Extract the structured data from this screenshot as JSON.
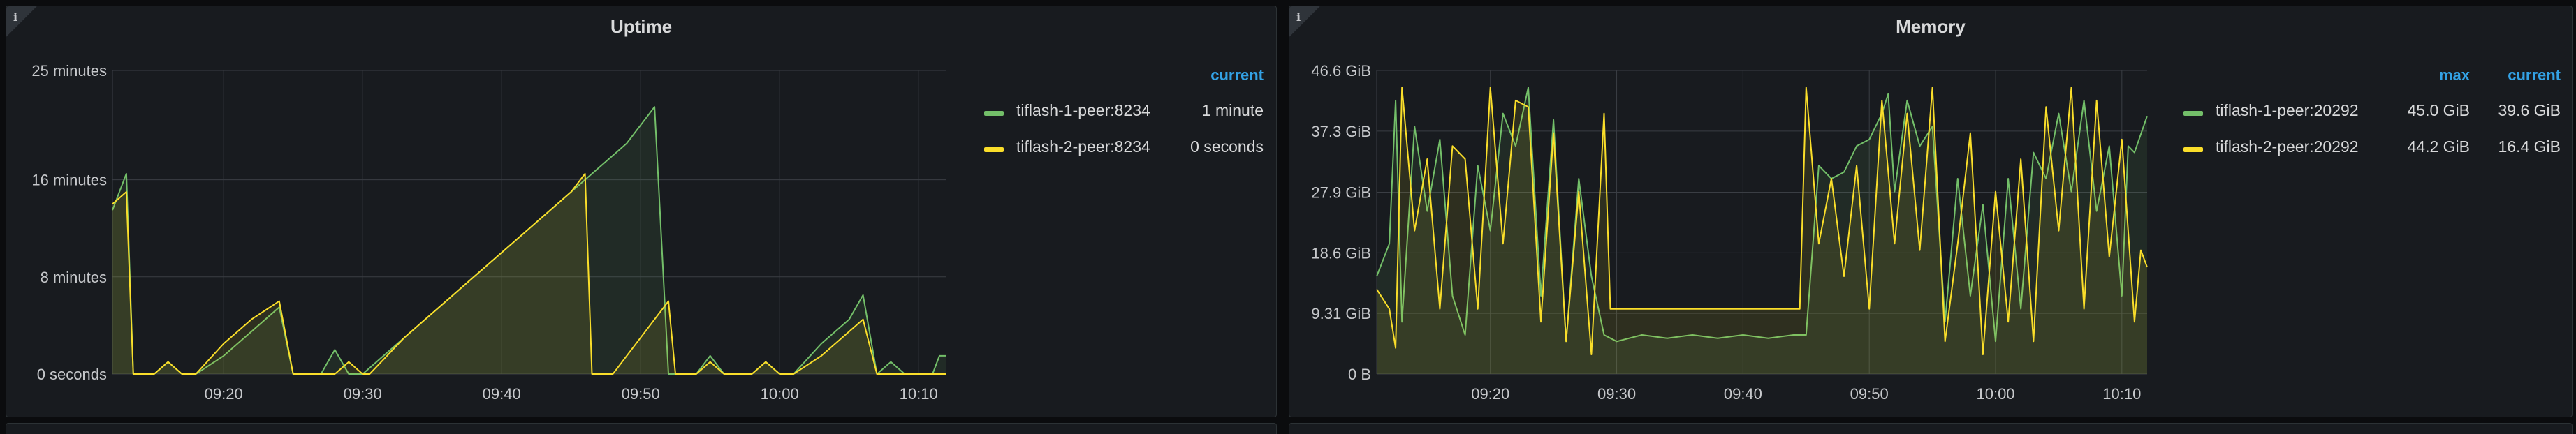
{
  "panels": [
    {
      "title": "Uptime",
      "info_icon": "info-icon",
      "legend": {
        "columns": [
          "current"
        ],
        "rows": [
          {
            "name": "tiflash-1-peer:8234",
            "color": "#73bf69",
            "values": [
              "1 minute"
            ]
          },
          {
            "name": "tiflash-2-peer:8234",
            "color": "#fade2a",
            "values": [
              "0 seconds"
            ]
          }
        ]
      }
    },
    {
      "title": "Memory",
      "info_icon": "info-icon",
      "legend": {
        "columns": [
          "max",
          "current"
        ],
        "rows": [
          {
            "name": "tiflash-1-peer:20292",
            "color": "#73bf69",
            "values": [
              "45.0 GiB",
              "39.6 GiB"
            ]
          },
          {
            "name": "tiflash-2-peer:20292",
            "color": "#fade2a",
            "values": [
              "44.2 GiB",
              "16.4 GiB"
            ]
          }
        ]
      }
    }
  ],
  "chart_data": [
    {
      "type": "area",
      "title": "Uptime",
      "x_unit": "time (HH:MM)",
      "x_ticks": [
        "09:20",
        "09:30",
        "09:40",
        "09:50",
        "10:00",
        "10:10"
      ],
      "x_range": [
        "09:12",
        "10:12"
      ],
      "y_unit": "minutes",
      "y_ticks": [
        {
          "value": 0,
          "label": "0 seconds"
        },
        {
          "value": 8,
          "label": "8 minutes"
        },
        {
          "value": 16,
          "label": "16 minutes"
        },
        {
          "value": 25,
          "label": "25 minutes"
        }
      ],
      "ylim": [
        0,
        25
      ],
      "grid": true,
      "legend_placement": "right",
      "series": [
        {
          "name": "tiflash-1-peer:8234",
          "color": "#73bf69",
          "points": [
            [
              "09:12",
              13.5
            ],
            [
              "09:13",
              16.5
            ],
            [
              "09:13.5",
              0
            ],
            [
              "09:15",
              0
            ],
            [
              "09:16",
              1
            ],
            [
              "09:17",
              0
            ],
            [
              "09:18",
              0
            ],
            [
              "09:20",
              1.5
            ],
            [
              "09:22",
              3.5
            ],
            [
              "09:24",
              5.5
            ],
            [
              "09:25",
              0
            ],
            [
              "09:27",
              0
            ],
            [
              "09:28",
              2
            ],
            [
              "09:29",
              0
            ],
            [
              "09:30",
              0
            ],
            [
              "09:32",
              2
            ],
            [
              "09:35",
              5
            ],
            [
              "09:38",
              8
            ],
            [
              "09:41",
              11
            ],
            [
              "09:44",
              14
            ],
            [
              "09:47",
              17
            ],
            [
              "09:49",
              19
            ],
            [
              "09:51",
              22
            ],
            [
              "09:52",
              0
            ],
            [
              "09:54",
              0
            ],
            [
              "09:55",
              1.5
            ],
            [
              "09:56",
              0
            ],
            [
              "09:58",
              0
            ],
            [
              "09:59",
              1
            ],
            [
              "10:00",
              0
            ],
            [
              "10:01",
              0
            ],
            [
              "10:03",
              2.5
            ],
            [
              "10:05",
              4.5
            ],
            [
              "10:06",
              6.5
            ],
            [
              "10:07",
              0
            ],
            [
              "10:08",
              1
            ],
            [
              "10:09",
              0
            ],
            [
              "10:11",
              0
            ],
            [
              "10:11.5",
              1.5
            ],
            [
              "10:12",
              1.5
            ]
          ]
        },
        {
          "name": "tiflash-2-peer:8234",
          "color": "#fade2a",
          "points": [
            [
              "09:12",
              14
            ],
            [
              "09:13",
              15
            ],
            [
              "09:13.5",
              0
            ],
            [
              "09:15",
              0
            ],
            [
              "09:16",
              1
            ],
            [
              "09:17",
              0
            ],
            [
              "09:18",
              0
            ],
            [
              "09:20",
              2.5
            ],
            [
              "09:22",
              4.5
            ],
            [
              "09:24",
              6
            ],
            [
              "09:25",
              0
            ],
            [
              "09:28",
              0
            ],
            [
              "09:29",
              1
            ],
            [
              "09:30",
              0
            ],
            [
              "09:30.5",
              0
            ],
            [
              "09:33",
              3
            ],
            [
              "09:36",
              6
            ],
            [
              "09:39",
              9
            ],
            [
              "09:42",
              12
            ],
            [
              "09:45",
              15
            ],
            [
              "09:46",
              16.5
            ],
            [
              "09:46.5",
              0
            ],
            [
              "09:48",
              0
            ],
            [
              "09:50",
              3
            ],
            [
              "09:52",
              6
            ],
            [
              "09:52.5",
              0
            ],
            [
              "09:54",
              0
            ],
            [
              "09:55",
              1
            ],
            [
              "09:56",
              0
            ],
            [
              "09:58",
              0
            ],
            [
              "09:59",
              1
            ],
            [
              "10:00",
              0
            ],
            [
              "10:01",
              0
            ],
            [
              "10:03",
              1.5
            ],
            [
              "10:05",
              3.5
            ],
            [
              "10:06",
              4.5
            ],
            [
              "10:07",
              0
            ],
            [
              "10:12",
              0
            ]
          ]
        }
      ]
    },
    {
      "type": "area",
      "title": "Memory",
      "x_unit": "time (HH:MM)",
      "x_ticks": [
        "09:20",
        "09:30",
        "09:40",
        "09:50",
        "10:00",
        "10:10"
      ],
      "x_range": [
        "09:11",
        "10:12"
      ],
      "y_unit": "GiB",
      "y_ticks": [
        {
          "value": 0,
          "label": "0 B"
        },
        {
          "value": 9.31,
          "label": "9.31 GiB"
        },
        {
          "value": 18.6,
          "label": "18.6 GiB"
        },
        {
          "value": 27.9,
          "label": "27.9 GiB"
        },
        {
          "value": 37.3,
          "label": "37.3 GiB"
        },
        {
          "value": 46.6,
          "label": "46.6 GiB"
        }
      ],
      "ylim": [
        0,
        46.6
      ],
      "grid": true,
      "legend_placement": "right",
      "series": [
        {
          "name": "tiflash-1-peer:20292",
          "color": "#73bf69",
          "points": [
            [
              "09:11",
              15
            ],
            [
              "09:12",
              20
            ],
            [
              "09:12.5",
              42
            ],
            [
              "09:13",
              8
            ],
            [
              "09:14",
              38
            ],
            [
              "09:15",
              25
            ],
            [
              "09:16",
              36
            ],
            [
              "09:17",
              12
            ],
            [
              "09:18",
              6
            ],
            [
              "09:19",
              32
            ],
            [
              "09:20",
              22
            ],
            [
              "09:21",
              40
            ],
            [
              "09:22",
              35
            ],
            [
              "09:23",
              44
            ],
            [
              "09:24",
              12
            ],
            [
              "09:25",
              39
            ],
            [
              "09:26",
              5
            ],
            [
              "09:27",
              30
            ],
            [
              "09:28",
              15
            ],
            [
              "09:29",
              6
            ],
            [
              "09:30",
              5
            ],
            [
              "09:32",
              6
            ],
            [
              "09:34",
              5.5
            ],
            [
              "09:36",
              6
            ],
            [
              "09:38",
              5.5
            ],
            [
              "09:40",
              6
            ],
            [
              "09:42",
              5.5
            ],
            [
              "09:44",
              6
            ],
            [
              "09:45",
              6
            ],
            [
              "09:46",
              32
            ],
            [
              "09:47",
              30
            ],
            [
              "09:48",
              31
            ],
            [
              "09:49",
              35
            ],
            [
              "09:50",
              36
            ],
            [
              "09:51",
              40
            ],
            [
              "09:51.5",
              43
            ],
            [
              "09:52",
              28
            ],
            [
              "09:53",
              42
            ],
            [
              "09:54",
              35
            ],
            [
              "09:55",
              38
            ],
            [
              "09:56",
              8
            ],
            [
              "09:57",
              30
            ],
            [
              "09:58",
              12
            ],
            [
              "09:59",
              26
            ],
            [
              "10:00",
              5
            ],
            [
              "10:01",
              30
            ],
            [
              "10:02",
              10
            ],
            [
              "10:03",
              34
            ],
            [
              "10:04",
              30
            ],
            [
              "10:05",
              40
            ],
            [
              "10:06",
              28
            ],
            [
              "10:07",
              42
            ],
            [
              "10:08",
              25
            ],
            [
              "10:09",
              35
            ],
            [
              "10:10",
              12
            ],
            [
              "10:10.5",
              35
            ],
            [
              "10:11",
              34
            ],
            [
              "10:12",
              39.6
            ]
          ]
        },
        {
          "name": "tiflash-2-peer:20292",
          "color": "#fade2a",
          "points": [
            [
              "09:11",
              13
            ],
            [
              "09:12",
              10
            ],
            [
              "09:12.5",
              4
            ],
            [
              "09:13",
              44
            ],
            [
              "09:14",
              22
            ],
            [
              "09:15",
              33
            ],
            [
              "09:16",
              10
            ],
            [
              "09:17",
              35
            ],
            [
              "09:18",
              33
            ],
            [
              "09:19",
              10
            ],
            [
              "09:20",
              44
            ],
            [
              "09:21",
              20
            ],
            [
              "09:22",
              42
            ],
            [
              "09:23",
              41
            ],
            [
              "09:24",
              8
            ],
            [
              "09:25",
              37
            ],
            [
              "09:26",
              5
            ],
            [
              "09:27",
              28
            ],
            [
              "09:28",
              3
            ],
            [
              "09:29",
              40
            ],
            [
              "09:29.5",
              10
            ],
            [
              "09:30",
              10
            ],
            [
              "09:34",
              10
            ],
            [
              "09:38",
              10
            ],
            [
              "09:42",
              10
            ],
            [
              "09:44.5",
              10
            ],
            [
              "09:45",
              44
            ],
            [
              "09:46",
              20
            ],
            [
              "09:47",
              30
            ],
            [
              "09:48",
              15
            ],
            [
              "09:49",
              32
            ],
            [
              "09:50",
              10
            ],
            [
              "09:51",
              42
            ],
            [
              "09:52",
              20
            ],
            [
              "09:53",
              40
            ],
            [
              "09:54",
              19
            ],
            [
              "09:55",
              44
            ],
            [
              "09:56",
              5
            ],
            [
              "09:57",
              20
            ],
            [
              "09:58",
              37
            ],
            [
              "09:59",
              3
            ],
            [
              "10:00",
              28
            ],
            [
              "10:01",
              8
            ],
            [
              "10:02",
              33
            ],
            [
              "10:03",
              5
            ],
            [
              "10:04",
              41
            ],
            [
              "10:05",
              22
            ],
            [
              "10:06",
              44
            ],
            [
              "10:07",
              10
            ],
            [
              "10:08",
              42
            ],
            [
              "10:09",
              18
            ],
            [
              "10:10",
              36
            ],
            [
              "10:11",
              8
            ],
            [
              "10:11.5",
              19
            ],
            [
              "10:12",
              16.4
            ]
          ]
        }
      ]
    }
  ]
}
